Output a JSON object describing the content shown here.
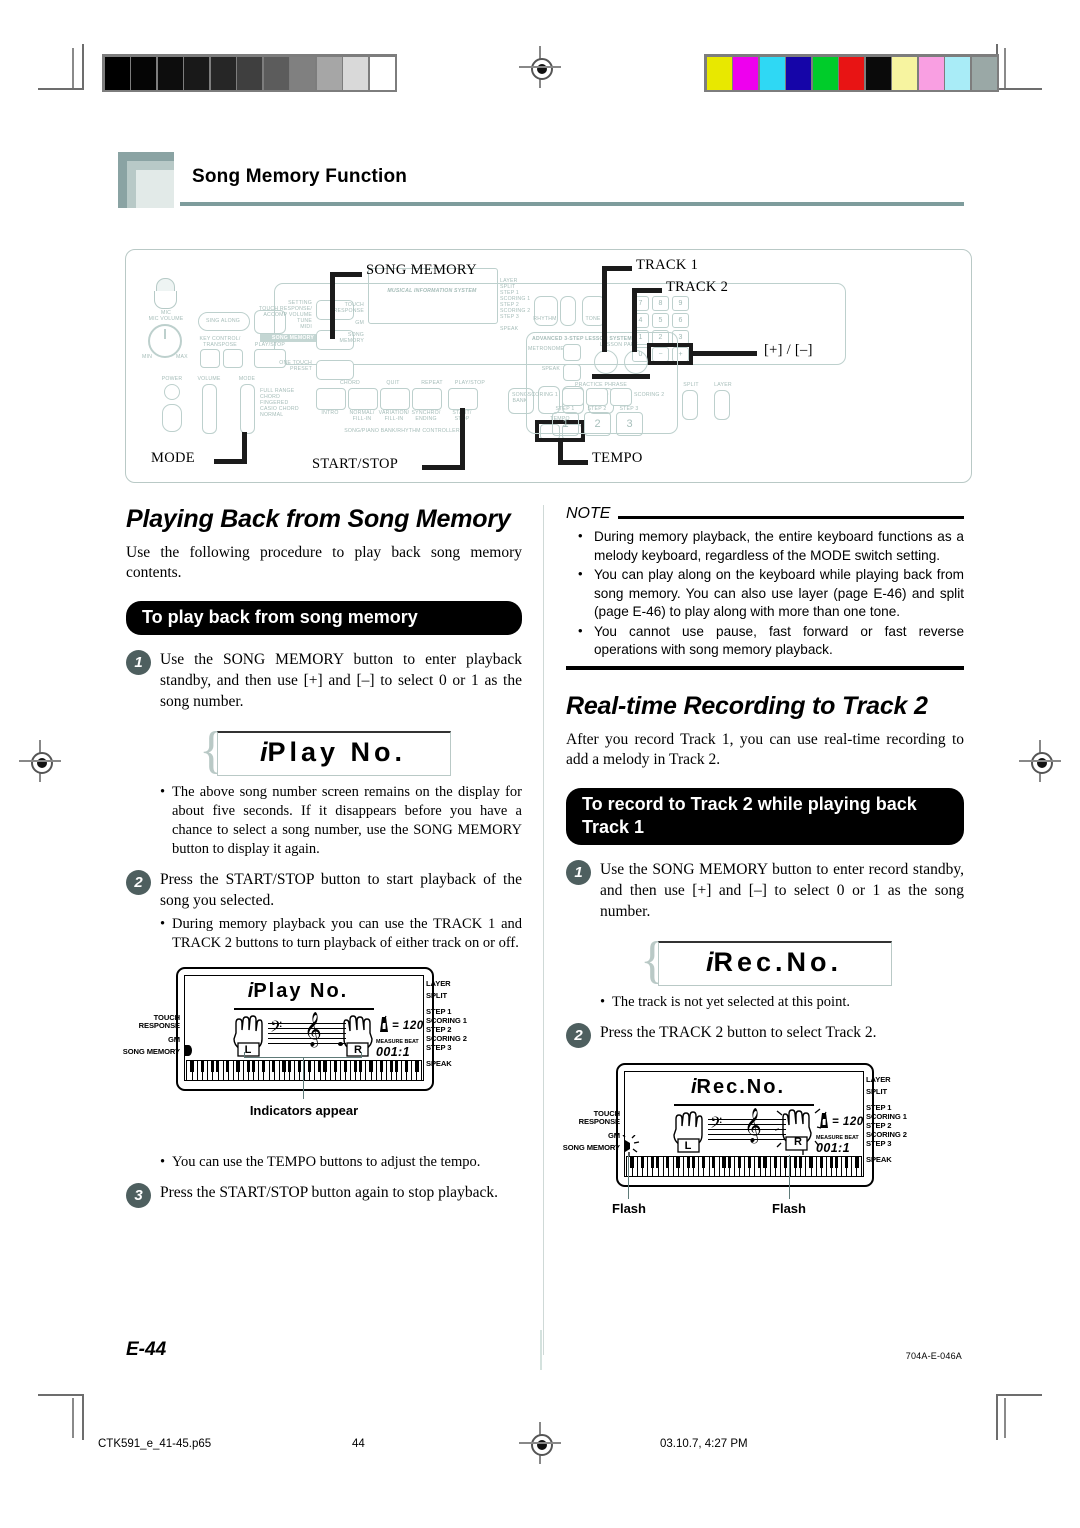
{
  "header": {
    "title": "Song Memory Function"
  },
  "panel_figure": {
    "callouts": {
      "song_memory": "SONG MEMORY",
      "track1": "TRACK 1",
      "track2": "TRACK 2",
      "plus_minus": "[+] / [–]",
      "mode": "MODE",
      "start_stop": "START/STOP",
      "tempo": "TEMPO"
    },
    "panel_labels": {
      "mic": "MIC",
      "mic_volume": "MIC VOLUME",
      "sing_along": "SING ALONG",
      "key_control": "KEY CONTROL/",
      "transpose": "TRANSPOSE",
      "play_stop": "PLAY/STOP",
      "setting": "SETTING",
      "touch_response": "TOUCH RESPONSE/",
      "accomp_volume": "ACCOMP VOLUME",
      "tune": "TUNE",
      "midi": "MIDI",
      "song_memory_btn": "SONG MEMORY",
      "one_touch_preset": "ONE TOUCH\nPRESET",
      "mis": "MUSICAL INFORMATION SYSTEM",
      "lcd_side": "TOUCH\nRESPONSE\n\nGM\n\nSONG MEMORY",
      "lcd_side_right": "LAYER\nSPLIT\nSTEP 1\nSCORING 1\nSTEP 2\nSCORING 2\nSTEP 3\n\nSPEAK",
      "rhythm": "RHYTHM",
      "tone": "TONE",
      "power": "POWER",
      "volume": "VOLUME",
      "mode": "MODE",
      "mode_opts": "FULL RANGE\nCHORD\nFINGERED\nCASIO CHORD\nNORMAL",
      "max": "MAX",
      "min": "MIN",
      "chord": "CHORD",
      "quit": "QUIT",
      "repeat": "REPEAT",
      "play_stop2": "PLAY/STOP",
      "intro": "INTRO",
      "normal_fill": "NORMAL/\nFILL-IN",
      "variation_fill": "VARIATION/\nFILL-IN",
      "synchro_ending": "SYNCHRO/\nENDING",
      "start_stop2": "START/\nSTOP",
      "ctrl_line": "SONG/PIANO BANK/RHYTHM CONTROLLER",
      "song_bank": "SONG\nBANK",
      "piano_bank": "PIANO\nBANK",
      "tempo_mark": "TEMPO",
      "lesson_system": "ADVANCED 3-STEP LESSON SYSTEM",
      "metronome": "METRONOME",
      "speak": "SPEAK",
      "lesson_part": "LESSON PART",
      "track_1_2": "TRACK 1   TRACK 2",
      "practice_phrase": "PRACTICE PHRASE",
      "scoring1": "SCORING 1",
      "scoring2": "SCORING 2",
      "step1": "STEP 1",
      "step2": "STEP 2",
      "step3": "STEP 3",
      "split": "SPLIT",
      "layer": "LAYER",
      "num_keys": [
        "7",
        "8",
        "9",
        "4",
        "5",
        "6",
        "1",
        "2",
        "3",
        "0",
        "–",
        "+"
      ]
    }
  },
  "left_column": {
    "heading": "Playing Back from Song Memory",
    "intro": "Use the following procedure to play back song memory contents.",
    "black_header": "To play back from song memory",
    "step1_num": "1",
    "step1_text": "Use the SONG MEMORY button to enter playback standby, and then use [+] and [–] to select 0 or 1 as the song number.",
    "display_strip": {
      "italic_i": "i",
      "text": "Play No."
    },
    "step1_bullets": [
      "The above song number screen remains on the display for about five seconds. If it disappears before you have a chance to select a song number, use the SONG MEMORY button to display it again."
    ],
    "step2_num": "2",
    "step2_text": "Press the START/STOP button to start playback of the song you selected.",
    "step2_bullets": [
      "During memory playback you can use the TRACK 1 and TRACK 2 buttons to turn playback of either track on or off."
    ],
    "lcd": {
      "italic_i": "i",
      "title": "Play No.",
      "left_labels": [
        "TOUCH",
        "RESPONSE",
        "GM",
        "SONG MEMORY"
      ],
      "right_labels": [
        "LAYER",
        "SPLIT",
        "STEP 1",
        "SCORING 1",
        "STEP 2",
        "SCORING 2",
        "STEP 3",
        "SPEAK"
      ],
      "hand_left": "L",
      "hand_right": "R",
      "tempo_value": "120",
      "measure_beat_label": "MEASURE BEAT",
      "measure_beat_value": "001:1"
    },
    "lcd_caption": "Indicators appear",
    "step2_bullets_after": [
      "You can use the TEMPO buttons to adjust the tempo."
    ],
    "step3_num": "3",
    "step3_text": "Press the START/STOP button again to stop playback."
  },
  "right_column": {
    "note_label": "NOTE",
    "note_items": [
      "During memory playback, the entire keyboard functions as a melody keyboard, regardless of the MODE switch setting.",
      "You can play along on the keyboard while playing back from song memory. You can also use layer (page E-46) and split (page E-46) to play along with more than one tone.",
      "You cannot use pause, fast forward or fast reverse operations with song memory playback."
    ],
    "heading": "Real-time Recording to Track 2",
    "intro": "After you record Track 1, you can use real-time recording to add a melody in Track 2.",
    "black_header": "To record to Track 2 while playing back Track 1",
    "step1_num": "1",
    "step1_text": "Use the SONG MEMORY button to enter record standby, and then use [+] and [–] to select 0 or 1 as the song number.",
    "display_strip": {
      "italic_i": "i",
      "text": "Rec.No."
    },
    "step1_bullets": [
      "The track is not yet selected at this point."
    ],
    "step2_num": "2",
    "step2_text": "Press the TRACK 2 button to select Track 2.",
    "lcd": {
      "italic_i": "i",
      "title": "Rec.No.",
      "left_labels": [
        "TOUCH",
        "RESPONSE",
        "GM",
        "SONG MEMORY"
      ],
      "right_labels": [
        "LAYER",
        "SPLIT",
        "STEP 1",
        "SCORING 1",
        "STEP 2",
        "SCORING 2",
        "STEP 3",
        "SPEAK"
      ],
      "hand_left": "L",
      "hand_right": "R",
      "tempo_value": "120",
      "measure_beat_label": "MEASURE BEAT",
      "measure_beat_value": "001:1"
    },
    "caption_left": "Flash",
    "caption_right": "Flash"
  },
  "footer": {
    "page_label": "E-44",
    "doc_id": "704A-E-046A",
    "file_name": "CTK591_e_41-45.p65",
    "page_number": "44",
    "timestamp": "03.10.7, 4:27 PM"
  },
  "colors": {
    "accent_teal": "#7e9c9c",
    "step_circle": "#4e5f5f",
    "panel_line": "#bdd0cd",
    "lead_line": "#5e7a78"
  },
  "gray_bar": [
    "#000000",
    "#050505",
    "#0d0d0d",
    "#191919",
    "#262626",
    "#3f3f3f",
    "#5c5c5c",
    "#808080",
    "#a6a6a6",
    "#d9d9d9",
    "#ffffff"
  ],
  "color_bar": [
    "#e8e800",
    "#ee00ee",
    "#2fd8f4",
    "#1505a8",
    "#00cc2a",
    "#e81414",
    "#0a0a0a",
    "#f7f4a0",
    "#f99fe2",
    "#a9ecf7",
    "#9aa8a6"
  ]
}
